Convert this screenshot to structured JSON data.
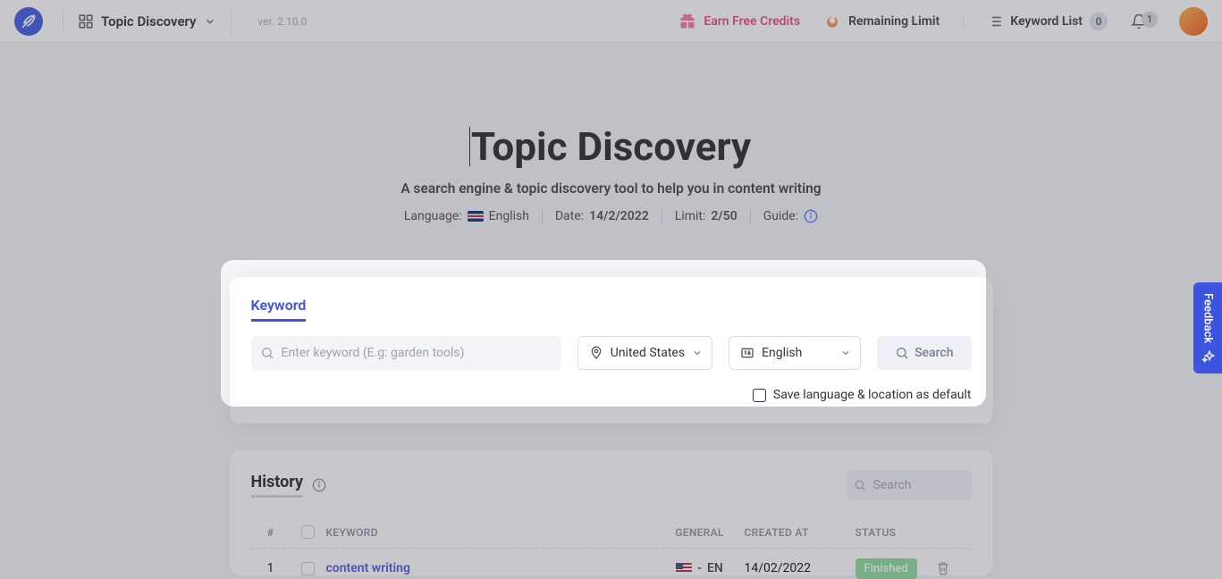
{
  "header": {
    "section_label": "Topic Discovery",
    "version": "ver. 2.10.0",
    "earn_credits": "Earn Free Credits",
    "remaining_limit": "Remaining Limit",
    "keyword_list": "Keyword List",
    "keyword_list_count": "0",
    "notif_count": "1"
  },
  "hero": {
    "title": "Topic Discovery",
    "subtitle": "A search engine & topic discovery tool to help you in content writing",
    "language_label": "Language:",
    "language_value": "English",
    "date_label": "Date:",
    "date_value": "14/2/2022",
    "limit_label": "Limit:",
    "limit_value": "2/50",
    "guide_label": "Guide:"
  },
  "card": {
    "tab": "Keyword",
    "input_placeholder": "Enter keyword (E.g: garden tools)",
    "input_value": "",
    "location": "United States",
    "language": "English",
    "search_btn": "Search",
    "save_default": "Save language & location as default"
  },
  "history": {
    "title": "History",
    "search_placeholder": "Search",
    "columns": {
      "num": "#",
      "keyword": "KEYWORD",
      "general": "GENERAL",
      "created": "CREATED AT",
      "status": "STATUS"
    },
    "rows": [
      {
        "num": "1",
        "keyword": "content writing",
        "general_lang": "EN",
        "created": "14/02/2022",
        "status": "Finished"
      }
    ]
  },
  "feedback": "Feedback"
}
